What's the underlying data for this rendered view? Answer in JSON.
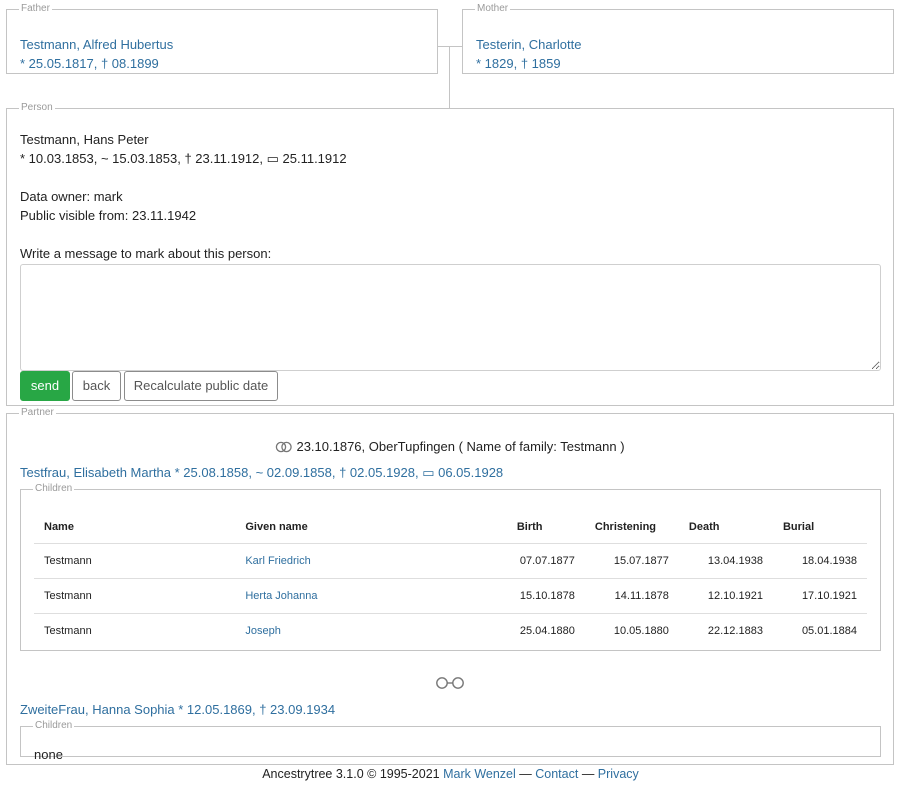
{
  "father": {
    "legend": "Father",
    "name": "Testmann, Alfred Hubertus",
    "dates": "* 25.05.1817, † 08.1899"
  },
  "mother": {
    "legend": "Mother",
    "name": "Testerin, Charlotte",
    "dates": "* 1829, † 1859"
  },
  "person": {
    "legend": "Person",
    "name": "Testmann, Hans Peter",
    "dates": "* 10.03.1853, ~ 15.03.1853, † 23.11.1912, ▭ 25.11.1912",
    "owner": "Data owner: mark",
    "public": "Public visible from: 23.11.1942",
    "message_label": "Write a message to mark about this person:",
    "message_value": "",
    "send_label": "send",
    "back_label": "back",
    "recalc_label": "Recalculate public date"
  },
  "partner": {
    "legend": "Partner",
    "marriage": "23.10.1876, OberTupfingen ( Name of family: Testmann )",
    "partners": [
      {
        "name": "Testfrau, Elisabeth Martha * 25.08.1858, ~ 02.09.1858, † 02.05.1928, ▭ 06.05.1928",
        "children_legend": "Children",
        "headers": [
          "Name",
          "Given name",
          "Birth",
          "Christening",
          "Death",
          "Burial"
        ],
        "rows": [
          [
            "Testmann",
            "Karl Friedrich",
            "07.07.1877",
            "15.07.1877",
            "13.04.1938",
            "18.04.1938"
          ],
          [
            "Testmann",
            "Herta Johanna",
            "15.10.1878",
            "14.11.1878",
            "12.10.1921",
            "17.10.1921"
          ],
          [
            "Testmann",
            "Joseph",
            "25.04.1880",
            "10.05.1880",
            "22.12.1883",
            "05.01.1884"
          ]
        ]
      },
      {
        "name": "ZweiteFrau, Hanna Sophia * 12.05.1869, † 23.09.1934",
        "children_legend": "Children",
        "none_text": "none"
      }
    ]
  },
  "footer": {
    "text": "Ancestrytree 3.1.0 © 1995-2021",
    "author": "Mark Wenzel",
    "sep1": " — ",
    "contact": "Contact",
    "sep2": " — ",
    "privacy": "Privacy"
  },
  "colors": {
    "link": "#2f6f9f",
    "send_button": "#28a745",
    "border": "#c4c4c4"
  }
}
